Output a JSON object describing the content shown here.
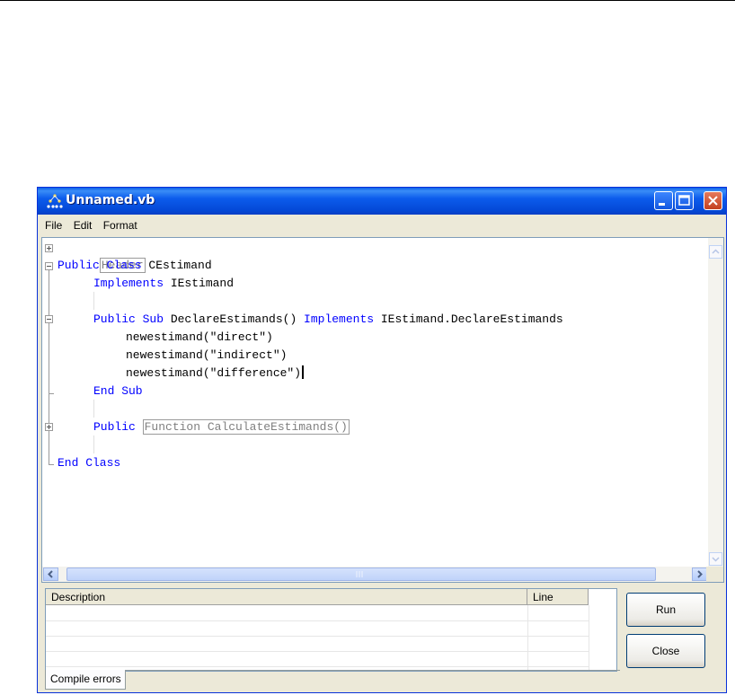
{
  "window": {
    "title": "Unnamed.vb",
    "controls": [
      "minimize-icon",
      "maximize-icon",
      "close-icon"
    ]
  },
  "menu": {
    "file": "File",
    "edit": "Edit",
    "format": "Format"
  },
  "code": {
    "header": "Header",
    "class_kw": "Public Class",
    "class_name": " CEstimand",
    "implements_kw": "Implements",
    "implements_iface": " IEstimand",
    "sub_kw": "Public Sub",
    "sub_sig": " DeclareEstimands() ",
    "sub_implements_kw": "Implements",
    "sub_implements_target": " IEstimand.DeclareEstimands",
    "line_direct": "newestimand(\"direct\")",
    "line_indirect": "newestimand(\"indirect\")",
    "line_difference": "newestimand(\"difference\")",
    "end_sub": "End Sub",
    "func_kw": "Public",
    "func_collapsed": "Function CalculateEstimands()",
    "end_class": "End Class"
  },
  "errors": {
    "columns": [
      "Description",
      "Line"
    ],
    "rows": [],
    "tab_label": "Compile errors"
  },
  "buttons": {
    "run": "Run",
    "close": "Close"
  },
  "colors": {
    "keyword": "#0000ff",
    "titlebar": "#0448d6"
  }
}
